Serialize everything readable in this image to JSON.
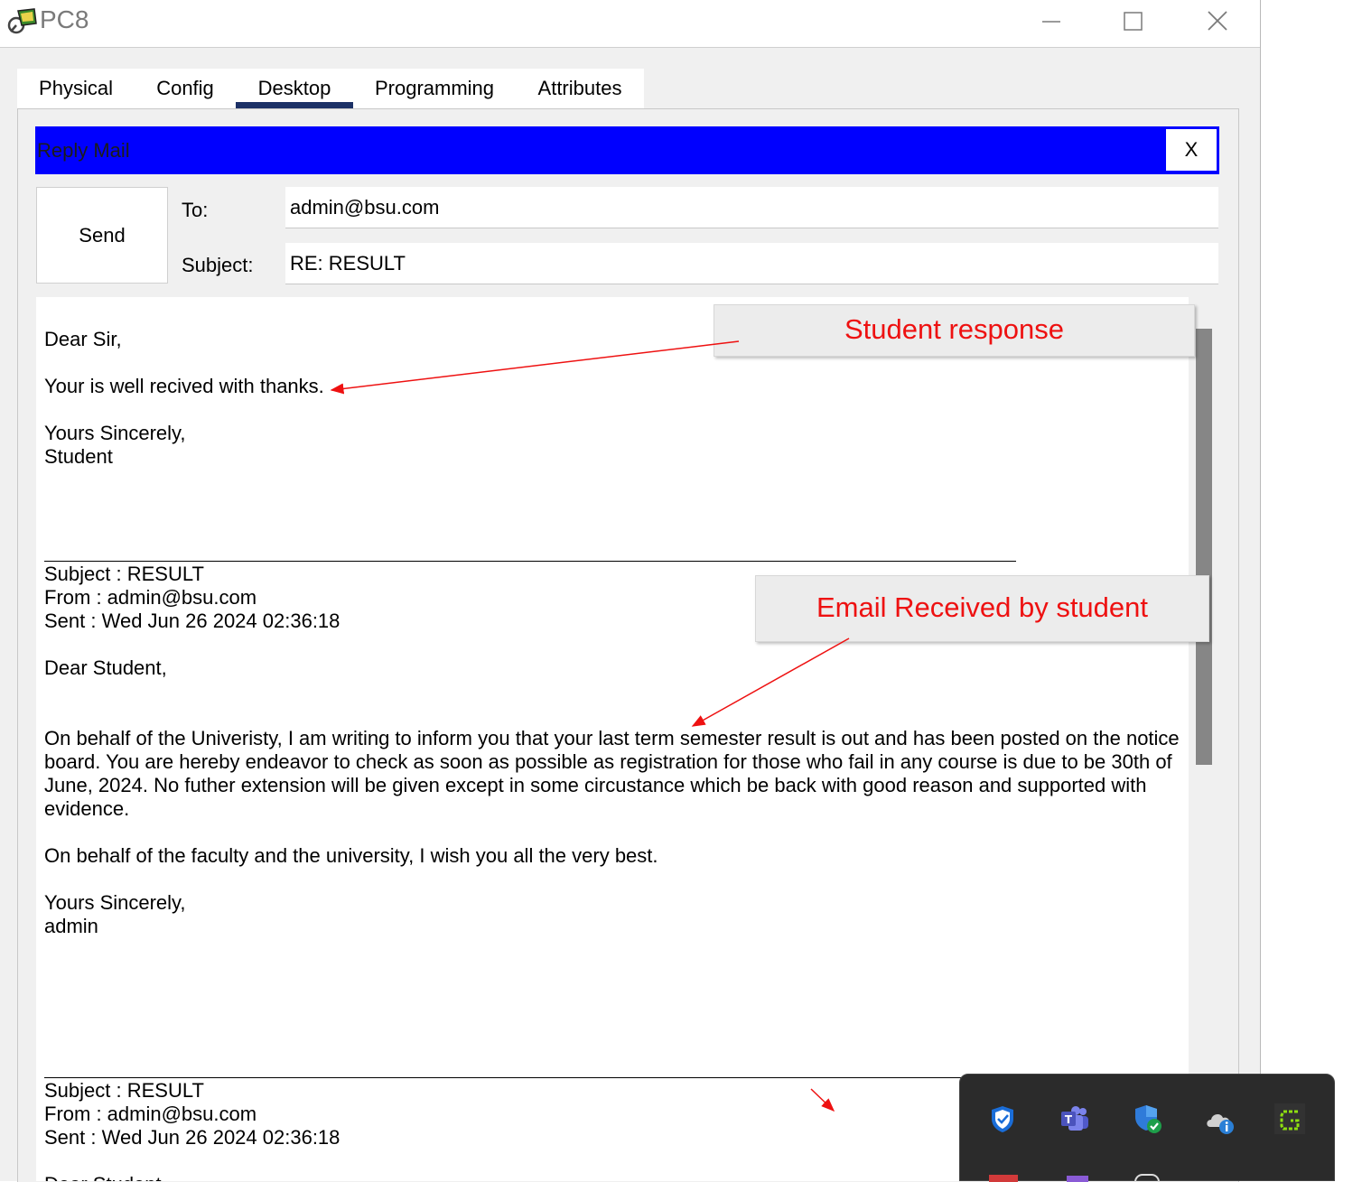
{
  "window": {
    "title": "PC8"
  },
  "tabs": [
    {
      "label": "Physical"
    },
    {
      "label": "Config"
    },
    {
      "label": "Desktop"
    },
    {
      "label": "Programming"
    },
    {
      "label": "Attributes"
    }
  ],
  "active_tab": "Desktop",
  "reply": {
    "title": "Reply Mail",
    "close_label": "X",
    "send_label": "Send",
    "to_label": "To:",
    "to_value": "admin@bsu.com",
    "subject_label": "Subject:",
    "subject_value": "RE: RESULT"
  },
  "body": {
    "response": "Dear Sir,\n\nYour is well recived with thanks.\n\nYours Sincerely,\nStudent",
    "quoted": "Subject : RESULT\nFrom : admin@bsu.com\nSent : Wed Jun 26 2024 02:36:18\n\nDear Student,\n\n\nOn behalf of the Univeristy, I am writing to inform you that your last term semester result is out and has been posted on the notice board. You are hereby endeavor to check as soon as possible as registration for those who fail in any course is due to be 30th of June, 2024. No futher extension will be given except in some circustance which be back with good reason and supported with evidence.\n\nOn behalf of the faculty and the university, I wish you all the very best.\n\nYours Sincerely,\nadmin",
    "quoted2": "Subject : RESULT\nFrom : admin@bsu.com\nSent : Wed Jun 26 2024 02:36:18\n\nDear Student,"
  },
  "annotations": {
    "student_response": "Student response",
    "email_received": "Email Received by student"
  },
  "colors": {
    "header_blue": "#0000ff",
    "annotation_red": "#ee1111",
    "tab_underline": "#1c3166"
  },
  "tray_icons": [
    "defender-shield-icon",
    "teams-icon",
    "windows-security-icon",
    "onedrive-info-icon",
    "greenshot-icon"
  ]
}
